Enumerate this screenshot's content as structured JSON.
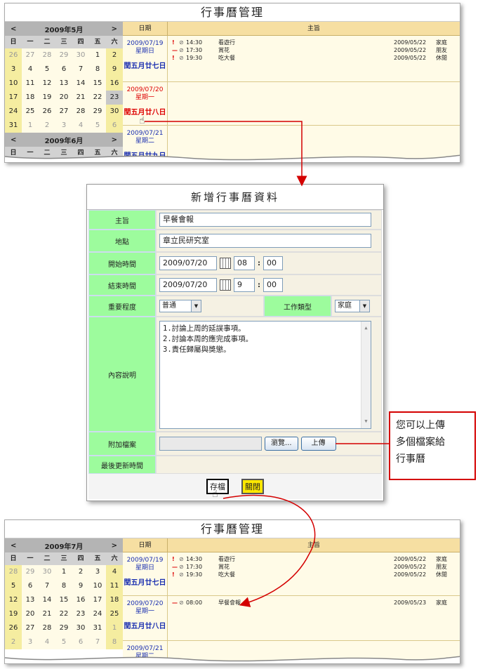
{
  "app_title": "行事曆管理",
  "top": {
    "calendars": [
      {
        "month": "2009年5月",
        "prev": "<",
        "next": ">",
        "weeks": [
          [
            "26",
            "27",
            "28",
            "29",
            "30",
            "1",
            "2"
          ],
          [
            "3",
            "4",
            "5",
            "6",
            "7",
            "8",
            "9"
          ],
          [
            "10",
            "11",
            "12",
            "13",
            "14",
            "15",
            "16"
          ],
          [
            "17",
            "18",
            "19",
            "20",
            "21",
            "22",
            "23"
          ],
          [
            "24",
            "25",
            "26",
            "27",
            "28",
            "29",
            "30"
          ],
          [
            "31",
            "1",
            "2",
            "3",
            "4",
            "5",
            "6"
          ]
        ]
      },
      {
        "month": "2009年6月",
        "prev": "<",
        "next": ">",
        "weeks": []
      }
    ],
    "weekdays": [
      "日",
      "一",
      "二",
      "三",
      "四",
      "五",
      "六"
    ],
    "col_date": "日期",
    "col_subject": "主旨",
    "days": [
      {
        "date": "2009/07/19",
        "weekday": "星期日",
        "lunar": "閏五月廿七日",
        "events": [
          {
            "mark": "!",
            "time": "14:30",
            "subject": "看遊行",
            "updated": "2009/05/22",
            "category": "家庭"
          },
          {
            "mark": "—",
            "time": "17:30",
            "subject": "賞花",
            "updated": "2009/05/22",
            "category": "朋友"
          },
          {
            "mark": "!",
            "time": "19:30",
            "subject": "吃大餐",
            "updated": "2009/05/22",
            "category": "休閒"
          }
        ]
      },
      {
        "date": "2009/07/20",
        "weekday": "星期一",
        "lunar": "閏五月廿八日",
        "events": []
      },
      {
        "date": "2009/07/21",
        "weekday": "星期二",
        "lunar": "閏五月廿九日",
        "events": []
      }
    ]
  },
  "form": {
    "title": "新增行事曆資料",
    "subject_label": "主旨",
    "subject_value": "早餐會報",
    "place_label": "地點",
    "place_value": "章立民研究室",
    "start_label": "開始時間",
    "start_date": "2009/07/20",
    "start_hour": "08",
    "start_min": "00",
    "end_label": "結束時間",
    "end_date": "2009/07/20",
    "end_hour": "9",
    "end_min": "00",
    "colon": ":",
    "priority_label": "重要程度",
    "priority_value": "普通",
    "type_label": "工作類型",
    "type_value": "家庭",
    "content_label": "內容說明",
    "content_lines": [
      "1.討論上周的延誤事項。",
      "2.討論本周的應完成事項。",
      "3.責任歸屬與獎懲。"
    ],
    "attach_label": "附加檔案",
    "browse_label": "瀏覽...",
    "upload_label": "上傳",
    "updated_label": "最後更新時間",
    "save_label": "存檔",
    "close_label": "關閉"
  },
  "callout": {
    "lines": [
      "您可以上傳",
      "多個檔案給",
      "行事曆"
    ]
  },
  "bottom": {
    "calendar": {
      "month": "2009年7月",
      "prev": "<",
      "next": ">",
      "weeks": [
        [
          "28",
          "29",
          "30",
          "1",
          "2",
          "3",
          "4"
        ],
        [
          "5",
          "6",
          "7",
          "8",
          "9",
          "10",
          "11"
        ],
        [
          "12",
          "13",
          "14",
          "15",
          "16",
          "17",
          "18"
        ],
        [
          "19",
          "20",
          "21",
          "22",
          "23",
          "24",
          "25"
        ],
        [
          "26",
          "27",
          "28",
          "29",
          "30",
          "31",
          "1"
        ],
        [
          "2",
          "3",
          "4",
          "5",
          "6",
          "7",
          "8"
        ]
      ]
    },
    "days": [
      {
        "date": "2009/07/19",
        "weekday": "星期日",
        "lunar": "閏五月廿七日",
        "events": [
          {
            "mark": "!",
            "time": "14:30",
            "subject": "看遊行",
            "updated": "2009/05/22",
            "category": "家庭"
          },
          {
            "mark": "—",
            "time": "17:30",
            "subject": "賞花",
            "updated": "2009/05/22",
            "category": "朋友"
          },
          {
            "mark": "!",
            "time": "19:30",
            "subject": "吃大餐",
            "updated": "2009/05/22",
            "category": "休閒"
          }
        ]
      },
      {
        "date": "2009/07/20",
        "weekday": "星期一",
        "lunar": "閏五月廿八日",
        "events": [
          {
            "mark": "—",
            "time": "08:00",
            "subject": "早餐會報",
            "updated": "2009/05/23",
            "category": "家庭"
          }
        ]
      },
      {
        "date": "2009/07/21",
        "weekday": "星期二",
        "lunar": "",
        "events": []
      }
    ]
  },
  "colors": {
    "accent_red": "#d40000",
    "label_green": "#9dfc9d",
    "header_tan": "#f6dfa2"
  }
}
